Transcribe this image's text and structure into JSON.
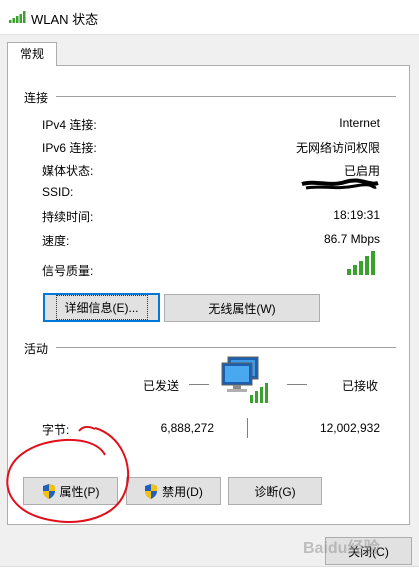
{
  "window": {
    "title": "WLAN 状态"
  },
  "tabs": [
    {
      "label": "常规"
    }
  ],
  "connection": {
    "section_label": "连接",
    "rows": [
      {
        "label": "IPv4 连接:",
        "value": "Internet"
      },
      {
        "label": "IPv6 连接:",
        "value": "无网络访问权限"
      },
      {
        "label": "媒体状态:",
        "value": "已启用"
      },
      {
        "label": "SSID:",
        "value": ""
      },
      {
        "label": "持续时间:",
        "value": "18:19:31"
      },
      {
        "label": "速度:",
        "value": "86.7 Mbps"
      },
      {
        "label": "信号质量:",
        "value": ""
      }
    ],
    "signal_bars": 5,
    "details_button": "详细信息(E)...",
    "wireless_button": "无线属性(W)"
  },
  "activity": {
    "section_label": "活动",
    "sent_label": "已发送",
    "received_label": "已接收",
    "bytes_label": "字节:",
    "bytes_sent": "6,888,272",
    "bytes_received": "12,002,932"
  },
  "buttons": {
    "properties": "属性(P)",
    "disable": "禁用(D)",
    "diagnose": "诊断(G)",
    "close": "关闭(C)"
  },
  "watermark": "Baidu经验",
  "colors": {
    "focus_border": "#0078d7",
    "signal_green": "#3aa02e",
    "annotation_red": "#e0101a"
  }
}
